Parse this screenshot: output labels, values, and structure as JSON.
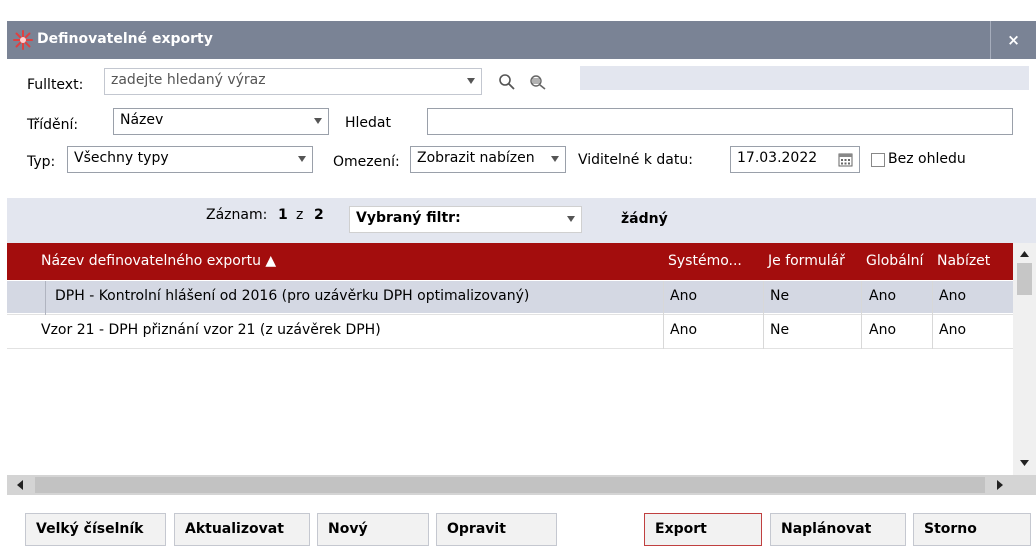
{
  "window": {
    "title": "Definovatelné exporty",
    "close_label": "×"
  },
  "filters": {
    "fulltext_label": "Fulltext:",
    "fulltext_placeholder": "zadejte hledaný výraz",
    "sort_label": "Třídění:",
    "sort_value": "Název",
    "search_label": "Hledat",
    "search_value": "",
    "type_label": "Typ:",
    "type_value": "Všechny typy",
    "limit_label": "Omezení:",
    "limit_value": "Zobrazit nabízen",
    "visible_label": "Viditelné k datu:",
    "visible_date": "17.03.2022",
    "ignore_label": "Bez ohledu"
  },
  "record_bar": {
    "record_label": "Záznam:",
    "current": "1",
    "of": "z",
    "total": "2",
    "filter_label": "Vybraný filtr:",
    "filter_value": "žádný"
  },
  "grid": {
    "columns": [
      "Název definovatelného exportu ▲",
      "Systémo...",
      "Je formulář",
      "Globální",
      "Nabízet"
    ],
    "rows": [
      [
        "DPH - Kontrolní hlášení od 2016 (pro uzávěrku DPH optimalizovaný)",
        "Ano",
        "Ne",
        "Ano",
        "Ano"
      ],
      [
        "Vzor 21 - DPH přiznání vzor 21 (z uzávěrek DPH)",
        "Ano",
        "Ne",
        "Ano",
        "Ano"
      ]
    ]
  },
  "buttons": {
    "big_codebook": "Velký číselník",
    "refresh": "Aktualizovat",
    "new": "Nový",
    "edit": "Opravit",
    "export": "Export",
    "schedule": "Naplánovat",
    "cancel": "Storno"
  },
  "colors": {
    "titlebar": "#7a8395",
    "grid_header": "#a30d0d",
    "selected_row": "#d4d8e3",
    "band": "#e3e6ef",
    "logo": "#e04040"
  }
}
